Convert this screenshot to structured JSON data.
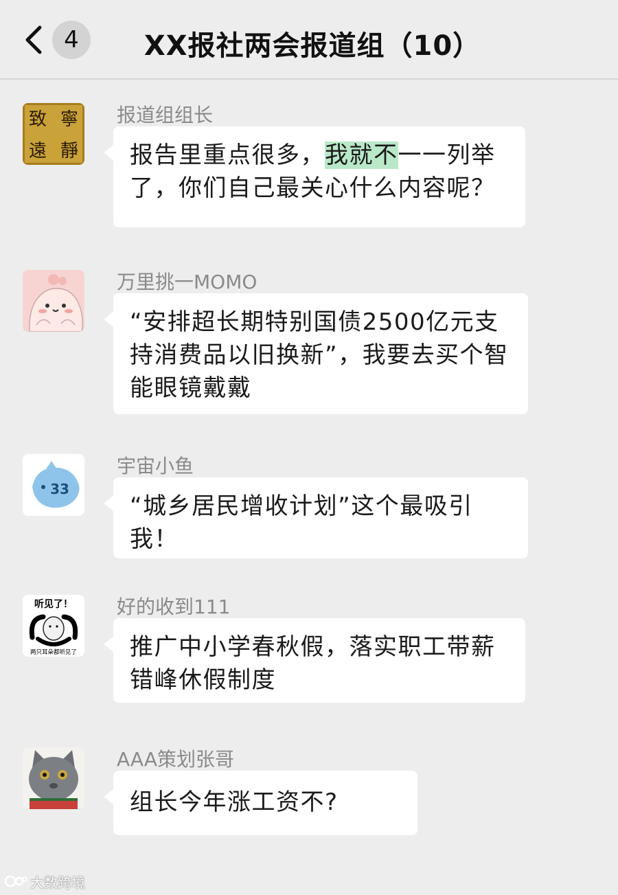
{
  "header": {
    "back_icon": "chevron-left-icon",
    "unread_count": "4",
    "title": "XX报社两会报道组（10）"
  },
  "messages": [
    {
      "sender": "报道组组长",
      "text_before": "报告里重点很多，",
      "text_highlight": "我就不",
      "text_after": "一一列举了，你们自己最关心什么内容呢？",
      "avatar": {
        "type": "calligraphy",
        "chars": [
          "致",
          "寧",
          "遠",
          "靜"
        ]
      }
    },
    {
      "sender": "万里挑一MOMO",
      "text": "“安排超长期特别国债2500亿元支持消费品以旧换新”，我要去买个智能眼镜戴戴",
      "avatar": {
        "type": "cartoon-pink-blob"
      }
    },
    {
      "sender": "宇宙小鱼",
      "text": "“城乡居民增收计划”这个最吸引我！",
      "avatar": {
        "type": "cartoon-blue-fish",
        "mark": "0 33"
      }
    },
    {
      "sender": "好的收到111",
      "text": "推广中小学春秋假，落实职工带薪错峰休假制度",
      "avatar": {
        "type": "meme",
        "top_text": "听见了！",
        "bottom_text": "两只耳朵都听见了"
      }
    },
    {
      "sender": "AAA策划张哥",
      "text": "组长今年涨工资不?",
      "avatar": {
        "type": "photo-grey-cat"
      }
    }
  ],
  "watermark": {
    "text": "大数跨境"
  },
  "colors": {
    "background": "#ededed",
    "bubble": "#ffffff",
    "highlight": "#b9e8c8",
    "sender_name": "#8a8a8a"
  }
}
